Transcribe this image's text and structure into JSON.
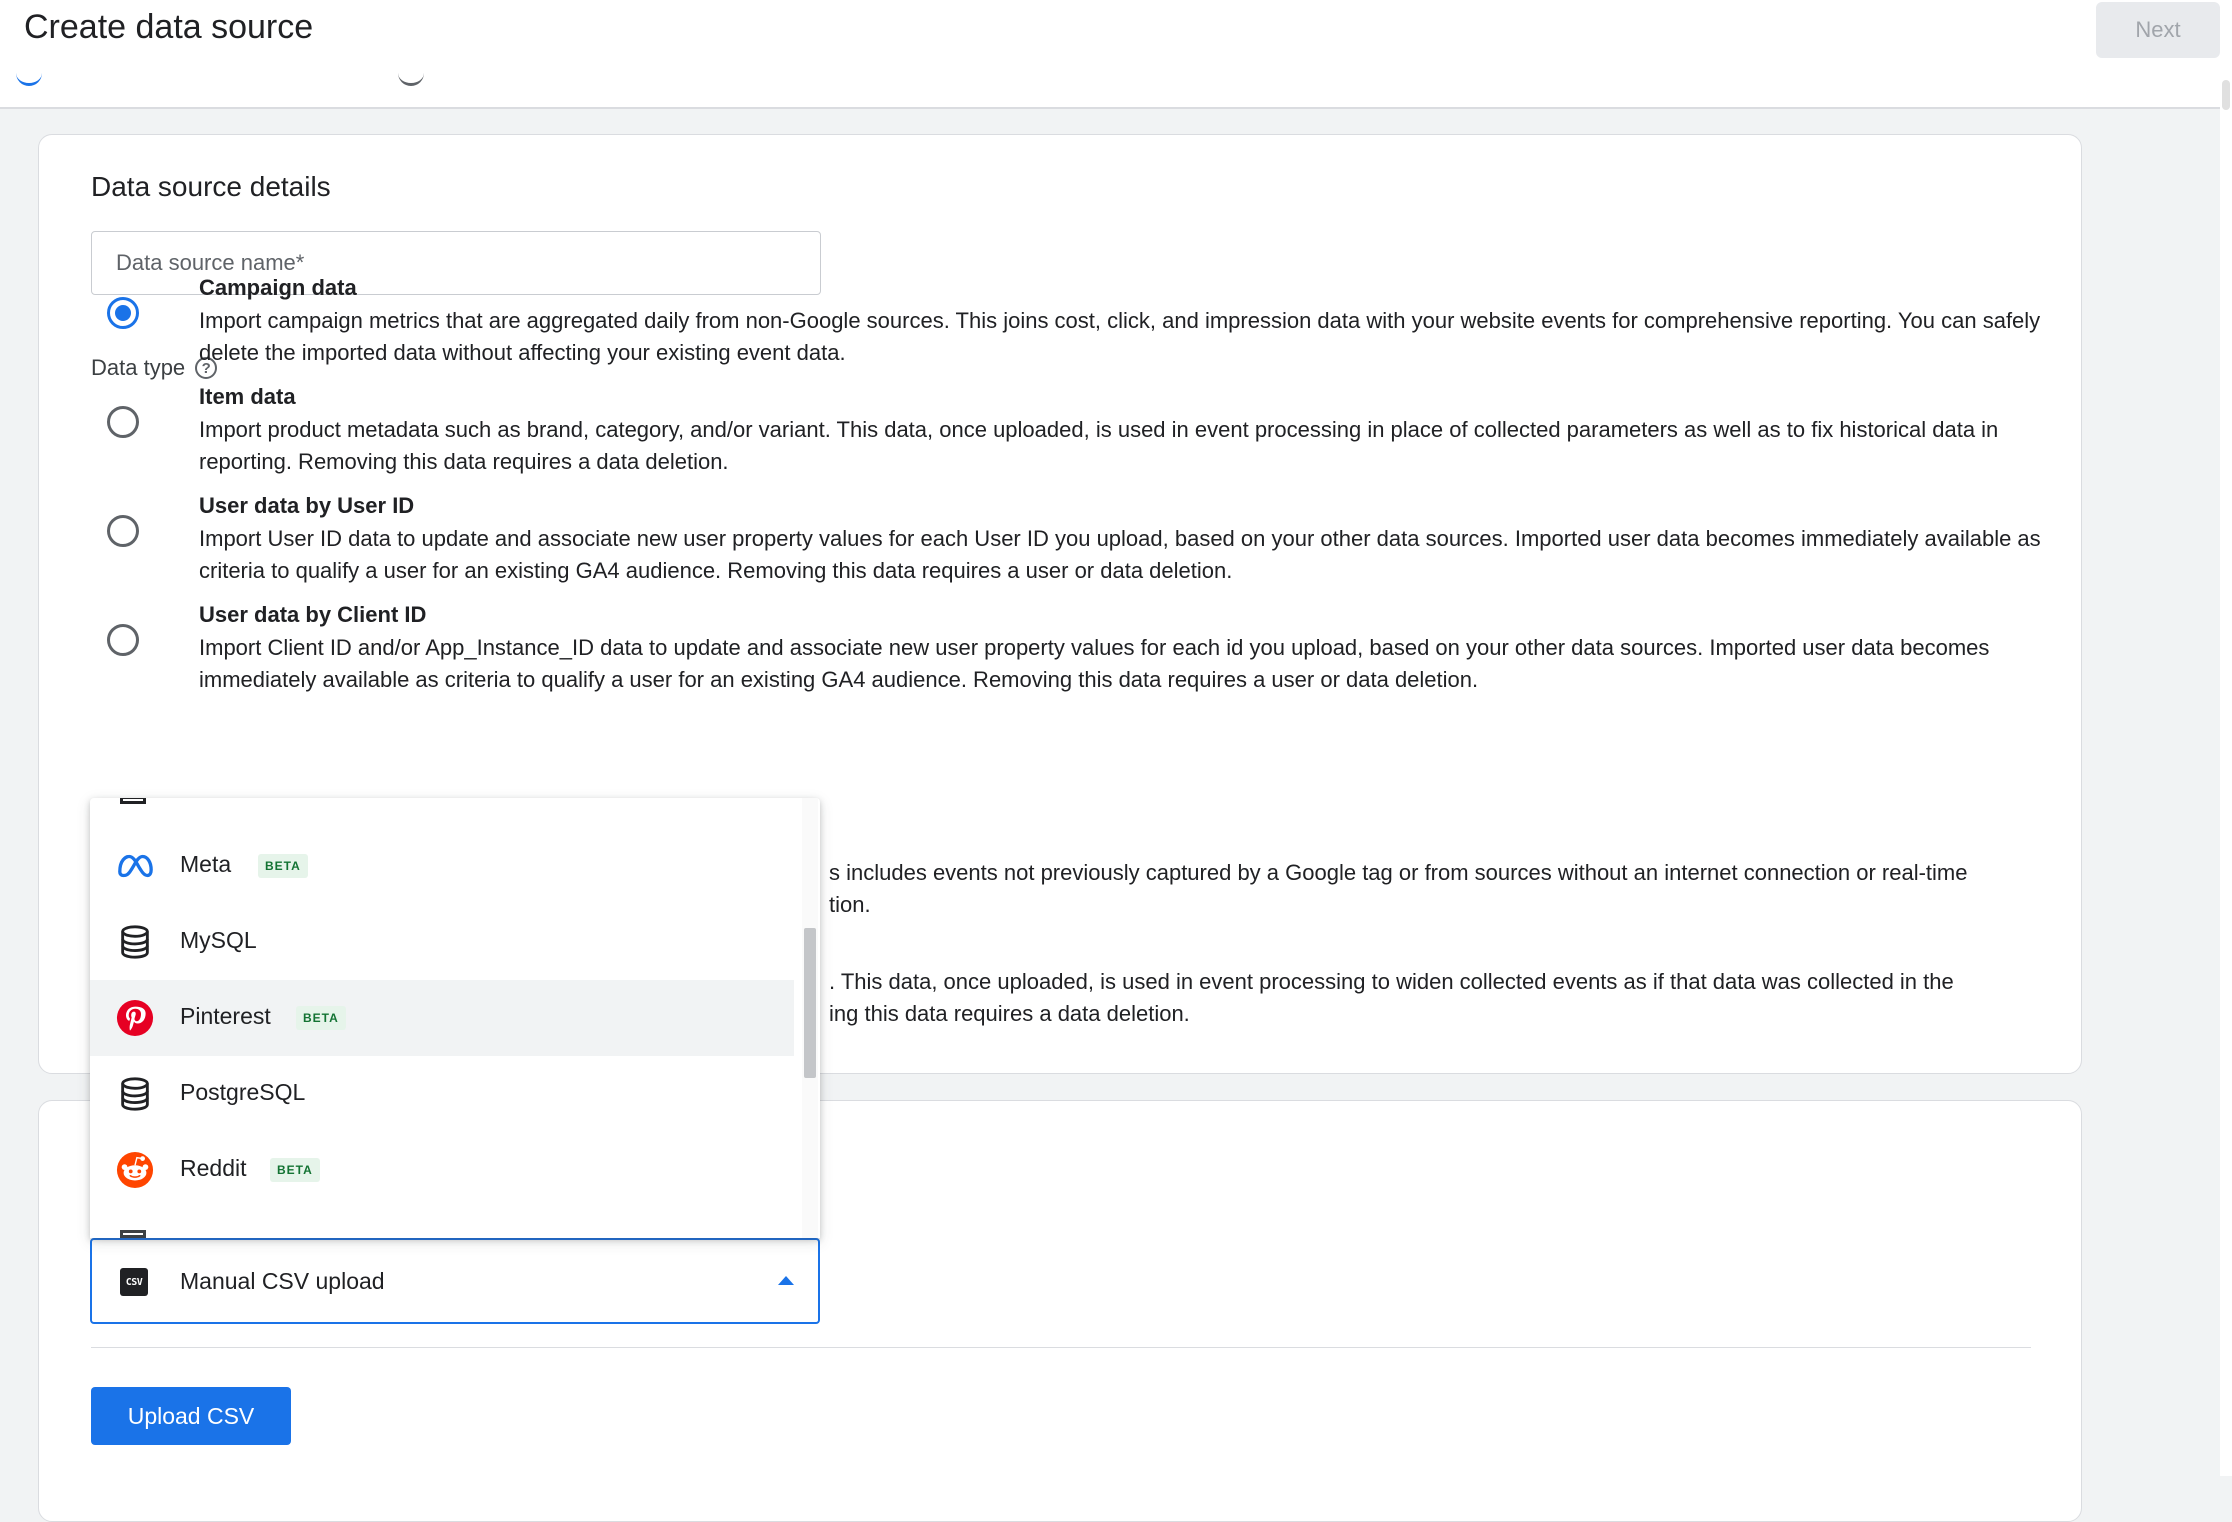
{
  "header": {
    "title": "Create data source",
    "next_label": "Next"
  },
  "details": {
    "section_title": "Data source details",
    "name_placeholder": "Data source name*",
    "data_type_label": "Data type",
    "help_glyph": "?",
    "options": [
      {
        "title": "Campaign data",
        "description": "Import campaign metrics that are aggregated daily from non-Google sources. This joins cost, click, and impression data with your website events for comprehensive reporting. You can safely delete the imported data without affecting your existing event data.",
        "selected": true
      },
      {
        "title": "Item data",
        "description": "Import product metadata such as brand, category, and/or variant. This data, once uploaded, is used in event processing in place of collected parameters as well as to fix historical data in reporting. Removing this data requires a data deletion.",
        "selected": false
      },
      {
        "title": "User data by User ID",
        "description": "Import User ID data to update and associate new user property values for each User ID you upload, based on your other data sources. Imported user data becomes immediately available as criteria to qualify a user for an existing GA4 audience. Removing this data requires a user or data deletion.",
        "selected": false
      },
      {
        "title": "User data by Client ID",
        "description": "Import Client ID and/or App_Instance_ID data to update and associate new user property values for each id you upload, based on your other data sources. Imported user data becomes immediately available as criteria to qualify a user for an existing GA4 audience. Removing this data requires a user or data deletion.",
        "selected": false
      }
    ],
    "hidden_option_5": {
      "line1": "s includes events not previously captured by a Google tag or from sources without an internet connection or real-time",
      "line2": "tion."
    },
    "hidden_option_6": {
      "line1": ". This data, once uploaded, is used in event processing to widen collected events as if that data was collected in the",
      "line2": "ing this data requires a data deletion."
    }
  },
  "source_select": {
    "selected_value": "Manual CSV upload",
    "selected_icon": "csv-icon",
    "csv_icon_text": "CSV",
    "items": [
      {
        "label": "Meta",
        "icon": "meta-icon",
        "badge": "BETA"
      },
      {
        "label": "MySQL",
        "icon": "database-icon",
        "badge": ""
      },
      {
        "label": "Pinterest",
        "icon": "pinterest-icon",
        "badge": "BETA"
      },
      {
        "label": "PostgreSQL",
        "icon": "database-icon",
        "badge": ""
      },
      {
        "label": "Reddit",
        "icon": "reddit-icon",
        "badge": "BETA"
      }
    ]
  },
  "upload": {
    "button_label": "Upload CSV"
  },
  "colors": {
    "accent": "#1a73e8",
    "pinterest": "#e60023",
    "reddit": "#ff4500",
    "beta_bg": "#e6f4ea",
    "beta_text": "#137333"
  }
}
